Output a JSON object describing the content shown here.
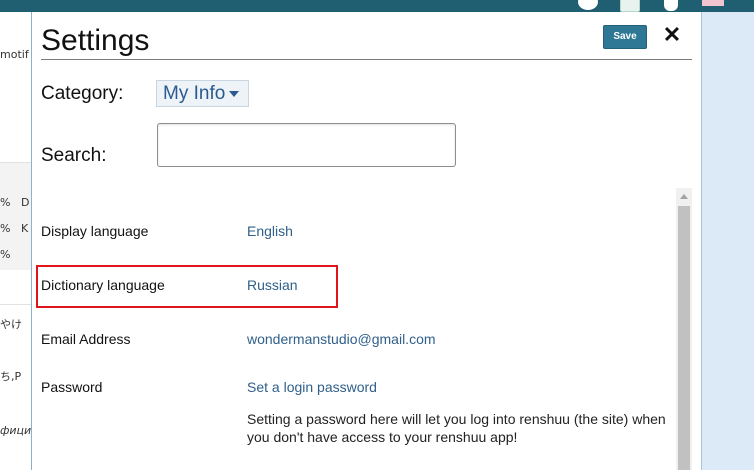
{
  "modal": {
    "title": "Settings",
    "save_label": "Save",
    "close_glyph": "✕"
  },
  "filters": {
    "category_label": "Category:",
    "category_value": "My Info",
    "search_label": "Search:",
    "search_value": "",
    "search_placeholder": ""
  },
  "settings": [
    {
      "label": "Display language",
      "value": "English"
    },
    {
      "label": "Dictionary language",
      "value": "Russian"
    },
    {
      "label": "Email Address",
      "value": "wondermanstudio@gmail.com"
    },
    {
      "label": "Password",
      "value": "Set a login password",
      "description": "Setting a password here will let you log into renshuu (the site) when you don't have access to your renshuu app!"
    }
  ],
  "background": {
    "fragments": [
      "motif",
      "%",
      "D",
      "%",
      "K",
      "%",
      "やけ",
      "ち,Р",
      "фици"
    ]
  },
  "highlight_color": "#e0141b",
  "accent_color": "#2e7895",
  "topbar_icons": [
    "help-icon",
    "note-icon",
    "user-icon",
    "flag-icon"
  ]
}
